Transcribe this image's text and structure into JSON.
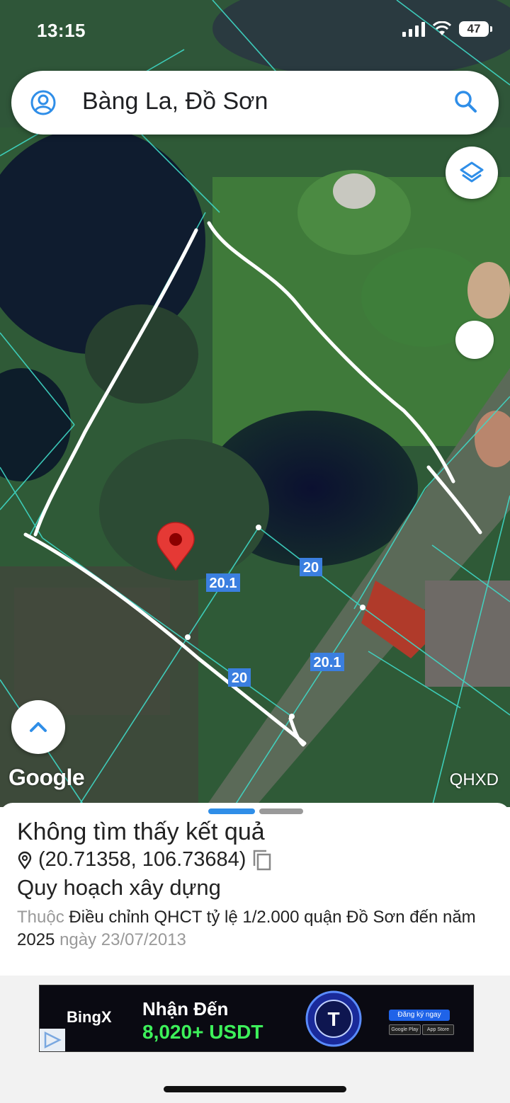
{
  "status": {
    "time": "13:15",
    "battery": "47"
  },
  "search": {
    "query": "Bàng La, Đồ Sơn"
  },
  "map": {
    "google_label": "Google",
    "layer_label": "QHXD",
    "dimension_labels": [
      "20.1",
      "20",
      "20",
      "20.1"
    ],
    "icons": {
      "account": "account-circle-icon",
      "search": "search-icon",
      "layers": "layers-icon",
      "expand": "chevron-up-icon",
      "marker": "map-pin-icon"
    }
  },
  "sheet": {
    "title": "Không tìm thấy kết quả",
    "coordinates": "(20.71358, 106.73684)",
    "subtitle": "Quy hoạch xây dựng",
    "desc_prefix": "Thuộc",
    "plan_name": "Điều chỉnh QHCT tỷ lệ 1/2.000 quận Đồ Sơn đến năm 2025",
    "date_prefix": "ngày",
    "date": "23/07/2013"
  },
  "ad": {
    "brand": "BingX",
    "line1": "Nhận Đến",
    "line2": "8,020+ USDT",
    "cta": "Đăng ký ngay",
    "store1": "Google Play",
    "store2": "App Store"
  },
  "colors": {
    "accent": "#2f8ee8",
    "boundary": "#3fd9c7",
    "marker": "#e53935",
    "label_bg": "#3b7fe0"
  }
}
